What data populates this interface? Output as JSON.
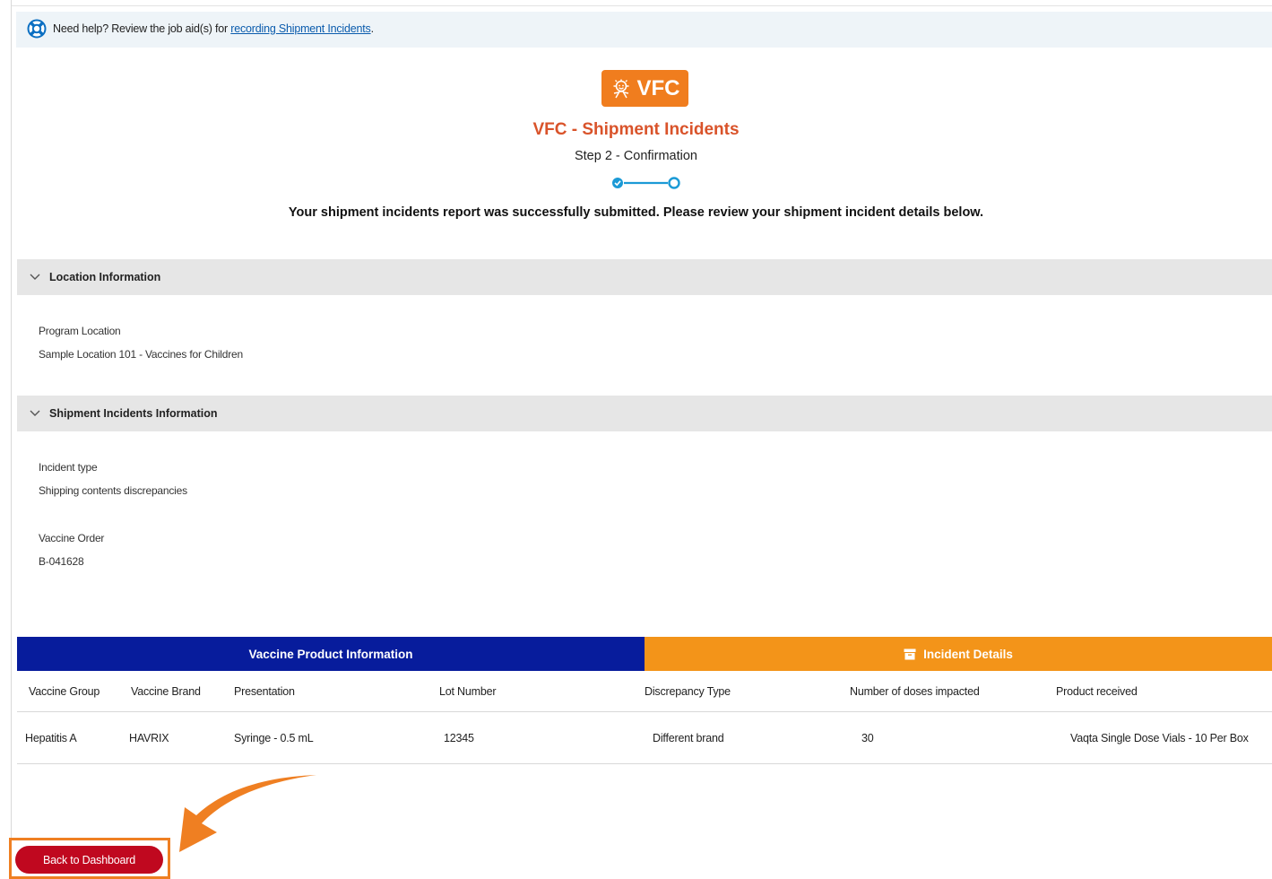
{
  "help": {
    "prefix": "Need help? Review the job aid(s) for ",
    "link": "recording Shipment Incidents",
    "suffix": ".",
    "icon": "lifebuoy-icon"
  },
  "logo": {
    "text": "VFC",
    "icon": "child-icon"
  },
  "title": "VFC - Shipment Incidents",
  "subtitle": "Step 2 - Confirmation",
  "progress": {
    "steps": 2,
    "completed": 1
  },
  "success_message": "Your shipment incidents report was successfully submitted. Please review your shipment incident details below.",
  "location_section": {
    "heading": "Location Information",
    "fields": [
      {
        "label": "Program Location",
        "value": "Sample Location 101 - Vaccines for Children"
      }
    ]
  },
  "incident_section": {
    "heading": "Shipment Incidents Information",
    "fields": [
      {
        "label": "Incident type",
        "value": "Shipping contents discrepancies"
      },
      {
        "label": "Vaccine Order",
        "value": "B-041628"
      }
    ]
  },
  "table": {
    "group_headers": [
      "Vaccine Product Information",
      "Incident Details"
    ],
    "columns": [
      "Vaccine Group",
      "Vaccine Brand",
      "Presentation",
      "Lot Number",
      "Discrepancy Type",
      "Number of doses impacted",
      "Product received"
    ],
    "rows": [
      [
        "Hepatitis A",
        "HAVRIX",
        "Syringe - 0.5 mL",
        "12345",
        "Different brand",
        "30",
        "Vaqta Single Dose Vials - 10 Per Box"
      ]
    ]
  },
  "back_button": "Back to Dashboard",
  "colors": {
    "title": "#d9532a",
    "vfc_orange": "#f07d1e",
    "product_header": "#071c9c",
    "incident_header": "#f39419",
    "button": "#c0081f",
    "annotation": "#ef7f22",
    "progress": "#1b9ad6"
  }
}
